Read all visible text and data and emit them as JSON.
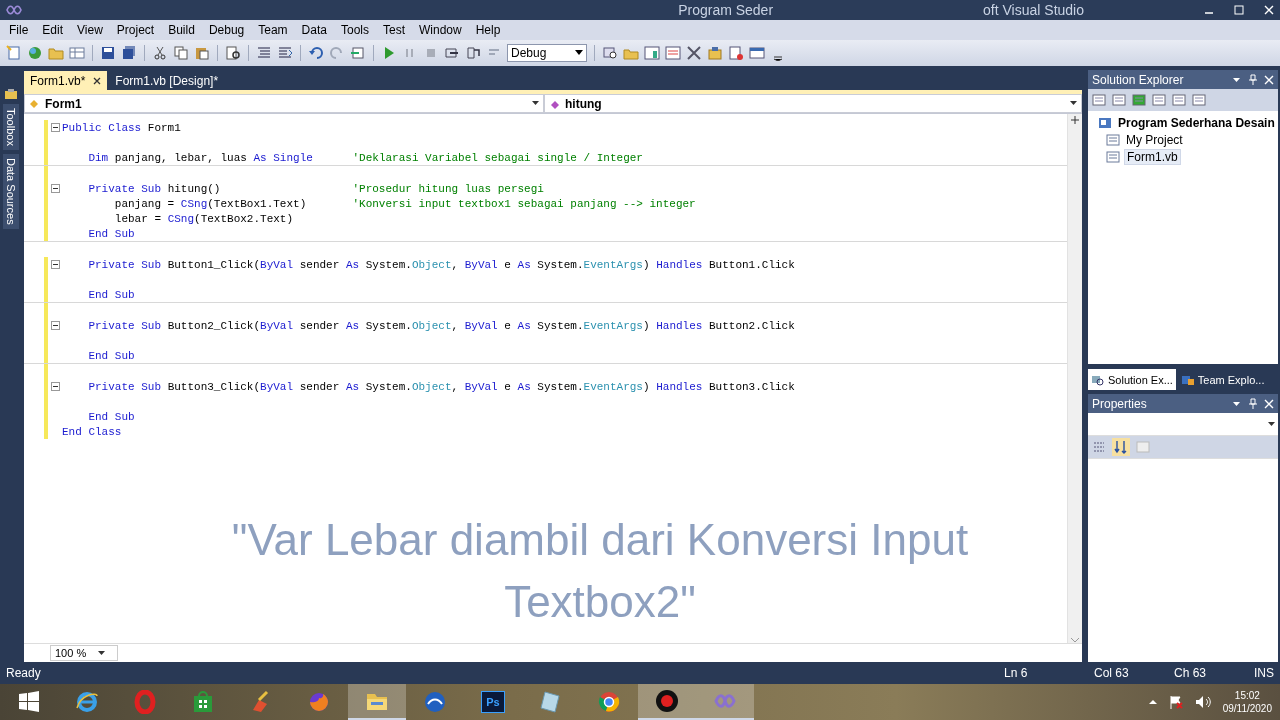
{
  "window": {
    "title_parts": [
      "Program Seder",
      "oft Visual Studio"
    ]
  },
  "menu": [
    "File",
    "Edit",
    "View",
    "Project",
    "Build",
    "Debug",
    "Team",
    "Data",
    "Tools",
    "Test",
    "Window",
    "Help"
  ],
  "toolbar": {
    "configuration": "Debug"
  },
  "side_tabs": [
    "Toolbox",
    "Data Sources"
  ],
  "editor_tabs": [
    {
      "label": "Form1.vb*",
      "selected": true
    },
    {
      "label": "Form1.vb [Design]*",
      "selected": false
    }
  ],
  "navigation": {
    "class_box": "Form1",
    "member_box": "hitung"
  },
  "code_lines": [
    {
      "kind": "code",
      "fold": true,
      "changed": true,
      "separator": false,
      "tokens": [
        {
          "kind": "keyword",
          "text": "Public Class"
        },
        {
          "kind": "plain",
          "text": " Form1"
        }
      ]
    },
    {
      "kind": "blank",
      "changed": true
    },
    {
      "kind": "code",
      "fold": false,
      "changed": true,
      "separator": true,
      "tokens": [
        {
          "kind": "keyword",
          "text": "    Dim"
        },
        {
          "kind": "plain",
          "text": " panjang, lebar, luas "
        },
        {
          "kind": "keyword",
          "text": "As Single      "
        },
        {
          "kind": "comment",
          "text": "'Deklarasi Variabel sebagai single / Integer"
        }
      ]
    },
    {
      "kind": "blank",
      "changed": true
    },
    {
      "kind": "code",
      "fold": true,
      "changed": true,
      "separator": false,
      "tokens": [
        {
          "kind": "keyword",
          "text": "    Private Sub"
        },
        {
          "kind": "plain",
          "text": " hitung()                    "
        },
        {
          "kind": "comment",
          "text": "'Prosedur hitung luas persegi"
        }
      ]
    },
    {
      "kind": "code",
      "fold": false,
      "changed": true,
      "separator": false,
      "tokens": [
        {
          "kind": "plain",
          "text": "        panjang = "
        },
        {
          "kind": "keyword",
          "text": "CSng"
        },
        {
          "kind": "plain",
          "text": "(TextBox1.Text)       "
        },
        {
          "kind": "comment",
          "text": "'Konversi input textbox1 sebagai panjang --> integer"
        }
      ]
    },
    {
      "kind": "code",
      "fold": false,
      "changed": true,
      "separator": false,
      "tokens": [
        {
          "kind": "plain",
          "text": "        lebar = "
        },
        {
          "kind": "keyword",
          "text": "CSng"
        },
        {
          "kind": "plain",
          "text": "(TextBox2.Text)"
        }
      ]
    },
    {
      "kind": "code",
      "fold": false,
      "changed": true,
      "separator": true,
      "tokens": [
        {
          "kind": "keyword",
          "text": "    End Sub"
        }
      ]
    },
    {
      "kind": "blank",
      "changed": false
    },
    {
      "kind": "code",
      "fold": true,
      "changed": true,
      "separator": false,
      "tokens": [
        {
          "kind": "keyword",
          "text": "    Private Sub"
        },
        {
          "kind": "plain",
          "text": " Button1_Click("
        },
        {
          "kind": "keyword",
          "text": "ByVal"
        },
        {
          "kind": "plain",
          "text": " sender "
        },
        {
          "kind": "keyword",
          "text": "As"
        },
        {
          "kind": "plain",
          "text": " System."
        },
        {
          "kind": "type",
          "text": "Object"
        },
        {
          "kind": "plain",
          "text": ", "
        },
        {
          "kind": "keyword",
          "text": "ByVal"
        },
        {
          "kind": "plain",
          "text": " e "
        },
        {
          "kind": "keyword",
          "text": "As"
        },
        {
          "kind": "plain",
          "text": " System."
        },
        {
          "kind": "type",
          "text": "EventArgs"
        },
        {
          "kind": "plain",
          "text": ") "
        },
        {
          "kind": "keyword",
          "text": "Handles"
        },
        {
          "kind": "plain",
          "text": " Button1.Click"
        }
      ]
    },
    {
      "kind": "blank",
      "changed": true
    },
    {
      "kind": "code",
      "fold": false,
      "changed": true,
      "separator": true,
      "tokens": [
        {
          "kind": "keyword",
          "text": "    End Sub"
        }
      ]
    },
    {
      "kind": "blank",
      "changed": true
    },
    {
      "kind": "code",
      "fold": true,
      "changed": true,
      "separator": false,
      "tokens": [
        {
          "kind": "keyword",
          "text": "    Private Sub"
        },
        {
          "kind": "plain",
          "text": " Button2_Click("
        },
        {
          "kind": "keyword",
          "text": "ByVal"
        },
        {
          "kind": "plain",
          "text": " sender "
        },
        {
          "kind": "keyword",
          "text": "As"
        },
        {
          "kind": "plain",
          "text": " System."
        },
        {
          "kind": "type",
          "text": "Object"
        },
        {
          "kind": "plain",
          "text": ", "
        },
        {
          "kind": "keyword",
          "text": "ByVal"
        },
        {
          "kind": "plain",
          "text": " e "
        },
        {
          "kind": "keyword",
          "text": "As"
        },
        {
          "kind": "plain",
          "text": " System."
        },
        {
          "kind": "type",
          "text": "EventArgs"
        },
        {
          "kind": "plain",
          "text": ") "
        },
        {
          "kind": "keyword",
          "text": "Handles"
        },
        {
          "kind": "plain",
          "text": " Button2.Click"
        }
      ]
    },
    {
      "kind": "blank",
      "changed": true
    },
    {
      "kind": "code",
      "fold": false,
      "changed": true,
      "separator": true,
      "tokens": [
        {
          "kind": "keyword",
          "text": "    End Sub"
        }
      ]
    },
    {
      "kind": "blank",
      "changed": true
    },
    {
      "kind": "code",
      "fold": true,
      "changed": true,
      "separator": false,
      "tokens": [
        {
          "kind": "keyword",
          "text": "    Private Sub"
        },
        {
          "kind": "plain",
          "text": " Button3_Click("
        },
        {
          "kind": "keyword",
          "text": "ByVal"
        },
        {
          "kind": "plain",
          "text": " sender "
        },
        {
          "kind": "keyword",
          "text": "As"
        },
        {
          "kind": "plain",
          "text": " System."
        },
        {
          "kind": "type",
          "text": "Object"
        },
        {
          "kind": "plain",
          "text": ", "
        },
        {
          "kind": "keyword",
          "text": "ByVal"
        },
        {
          "kind": "plain",
          "text": " e "
        },
        {
          "kind": "keyword",
          "text": "As"
        },
        {
          "kind": "plain",
          "text": " System."
        },
        {
          "kind": "type",
          "text": "EventArgs"
        },
        {
          "kind": "plain",
          "text": ") "
        },
        {
          "kind": "keyword",
          "text": "Handles"
        },
        {
          "kind": "plain",
          "text": " Button3.Click"
        }
      ]
    },
    {
      "kind": "blank",
      "changed": true
    },
    {
      "kind": "code",
      "fold": false,
      "changed": true,
      "separator": false,
      "tokens": [
        {
          "kind": "keyword",
          "text": "    End Sub"
        }
      ]
    },
    {
      "kind": "code",
      "fold": false,
      "changed": true,
      "separator": false,
      "tokens": [
        {
          "kind": "keyword",
          "text": "End Class"
        }
      ]
    }
  ],
  "caption": "\"Var Lebar diambil dari Konversi Input Textbox2\"",
  "zoom": "100 %",
  "solution_explorer": {
    "title": "Solution Explorer",
    "tree": [
      {
        "label": "Program Sederhana Desain",
        "selected": false,
        "children": [
          {
            "label": "My Project",
            "selected": false
          },
          {
            "label": "Form1.vb",
            "selected": true
          }
        ]
      }
    ],
    "tabs": [
      {
        "label": "Solution Ex...",
        "selected": true
      },
      {
        "label": "Team Explo...",
        "selected": false
      }
    ]
  },
  "properties": {
    "title": "Properties"
  },
  "status_bar": {
    "message": "Ready",
    "line": "Ln 6",
    "column": "Col 63",
    "char": "Ch 63",
    "mode": "INS"
  },
  "taskbar": {
    "apps": [
      {
        "kind": "start",
        "active": false
      },
      {
        "kind": "ie",
        "active": false
      },
      {
        "kind": "opera",
        "active": false
      },
      {
        "kind": "store",
        "active": false
      },
      {
        "kind": "brush",
        "active": false
      },
      {
        "kind": "firefox",
        "active": false
      },
      {
        "kind": "folder",
        "active": true
      },
      {
        "kind": "wave",
        "active": false
      },
      {
        "kind": "ps",
        "label": "Ps",
        "active": false
      },
      {
        "kind": "doc",
        "active": false
      },
      {
        "kind": "chrome",
        "active": false
      },
      {
        "kind": "record",
        "active": true
      },
      {
        "kind": "vs",
        "active": true
      }
    ],
    "clock": {
      "time": "15:02",
      "date": "09/11/2020"
    }
  }
}
